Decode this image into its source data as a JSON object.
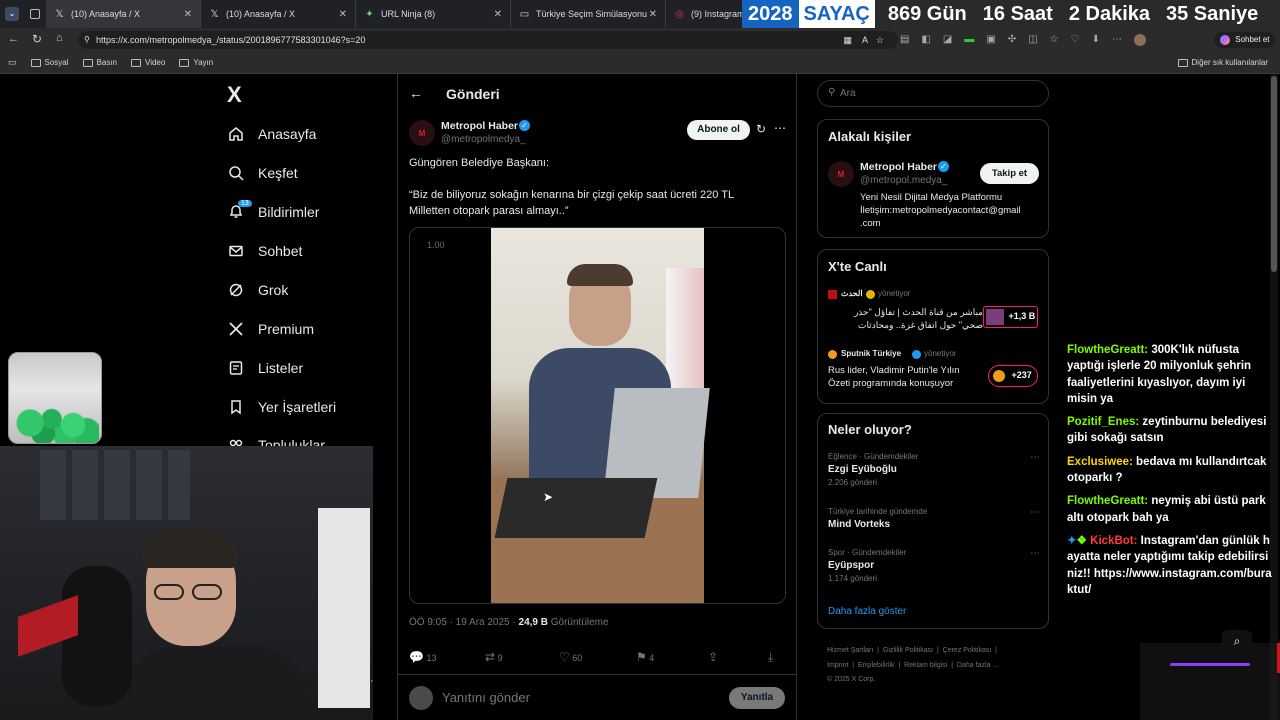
{
  "browser": {
    "tabs": [
      {
        "title": "(10) Anasayfa / X",
        "icon": "x-logo-icon"
      },
      {
        "title": "(10) Anasayfa / X",
        "icon": "x-logo-icon"
      },
      {
        "title": "URL Ninja (8)",
        "icon": "link-icon"
      },
      {
        "title": "Türkiye Seçim Simülasyonu",
        "icon": "page-icon"
      },
      {
        "title": "(9) Instagram",
        "icon": "instagram-icon"
      }
    ],
    "url": "https://x.com/metropolmedya_/status/2001896777583301046?s=20",
    "bookmarks": [
      "Sosyal",
      "Basın",
      "Video",
      "Yayın"
    ],
    "other_bookmarks": "Diğer sık kullanılanlar",
    "copilot_label": "Sohbet et"
  },
  "counter": {
    "year": "2028",
    "label": "SAYAÇ",
    "days": "869 Gün",
    "hours": "16 Saat",
    "minutes": "2 Dakika",
    "seconds": "35 Saniye"
  },
  "x_nav": {
    "logo": "X",
    "items": [
      {
        "label": "Anasayfa",
        "icon": "home-icon"
      },
      {
        "label": "Keşfet",
        "icon": "search-icon"
      },
      {
        "label": "Bildirimler",
        "icon": "bell-icon",
        "badge": "13"
      },
      {
        "label": "Sohbet",
        "icon": "mail-icon"
      },
      {
        "label": "Grok",
        "icon": "grok-icon"
      },
      {
        "label": "Premium",
        "icon": "x-logo-icon"
      },
      {
        "label": "Listeler",
        "icon": "list-icon"
      },
      {
        "label": "Yer İşaretleri",
        "icon": "bookmark-icon"
      },
      {
        "label": "Topluluklar",
        "icon": "community-icon"
      }
    ]
  },
  "post": {
    "header_title": "Gönderi",
    "author_name": "Metropol Haber",
    "author_handle": "@metropolmedya_",
    "subscribe_label": "Abone ol",
    "text_line1": "Güngören Belediye Başkanı:",
    "text_line2": "“Biz de biliyoruz sokağın kenarına bir çizgi çekip saat ücreti 220 TL",
    "text_line3": "Milletten otopark parası almayı..”",
    "video_speed": "1.00",
    "time": "ÖÖ 9:05 · 19 Ara 2025 ·",
    "views": "24,9 B",
    "views_label": "Görüntüleme",
    "replies": "13",
    "reposts": "9",
    "likes": "60",
    "bookmarks": "4",
    "reply_placeholder": "Yanıtını gönder",
    "reply_button": "Yanıtla"
  },
  "right": {
    "search_placeholder": "Ara",
    "related": {
      "title": "Alakalı kişiler",
      "name": "Metropol Haber",
      "handle": "@metropol.medya_",
      "follow_label": "Takip et",
      "bio_line1": "Yeni Nesil Dijital Medya Platformu",
      "bio_line2": "İletişim:metropolmedyacontact@gmail",
      "bio_line3": ".com"
    },
    "live": {
      "title": "X'te Canlı",
      "items": [
        {
          "host": "الحدث",
          "status": "yönetiyor",
          "line1": "مباشر من قناة الحدث | تفاؤل \"حذر",
          "line2": "صحي\" حول اتفاق غزة.. ومحادثات",
          "count": "+1,3 B"
        },
        {
          "host": "Sputnik Türkiye",
          "status": "yönetiyor",
          "line1": "Rus lider, Vladimir Putin'le Yılın",
          "line2": "Özeti programında konuşuyor",
          "count": "+237"
        }
      ]
    },
    "trends": {
      "title": "Neler oluyor?",
      "items": [
        {
          "context": "Eğlence · Gündemdekiler",
          "name": "Ezgi Eyüboğlu",
          "posts": "2.206 gönderi"
        },
        {
          "context": "Türkiye tarihinde gündemde",
          "name": "Mind Vorteks",
          "posts": ""
        },
        {
          "context": "Spor · Gündemdekiler",
          "name": "Eyüpspor",
          "posts": "1.174 gönderi"
        }
      ],
      "show_more": "Daha fazla göster"
    },
    "footer": {
      "line1": "Hizmet Şartları  |  Gizlilik Politikası  |  Çerez Politikası  |",
      "line2": "Imprint  |  Erişilebilirlik  |  Reklam bilgisi  |  Daha fazla ...",
      "line3": "© 2025 X Corp."
    }
  },
  "chat": [
    {
      "user": "FlowtheGreatt:",
      "color": "#7CFC00",
      "text": "300K'lık nüfusta yaptığı işlerle 20 milyonluk şehrin faaliyetlerini kıyaslıyor, dayım iyi misin ya"
    },
    {
      "user": "Pozitif_Enes:",
      "color": "#7CFC00",
      "text": "zeytinburnu belediyesi gibi sokağı satsın"
    },
    {
      "user": "Exclusiwee:",
      "color": "#FFD700",
      "text": "bedava mı kullandırtcak otoparkı ?"
    },
    {
      "user": "FlowtheGreatt:",
      "color": "#7CFC00",
      "text": "neymiş abi üstü park altı otopark bah ya"
    },
    {
      "user": "KickBot:",
      "color": "#ff3b3b",
      "text": "Instagram'dan günlük hayatta neler yaptığımı takip edebilirsiniz!! https://www.instagram.com/buraktut/"
    }
  ],
  "colors": {
    "accent": "#1d9bf0",
    "verified": "#1d9bf0",
    "live_pink": "#f91880"
  }
}
